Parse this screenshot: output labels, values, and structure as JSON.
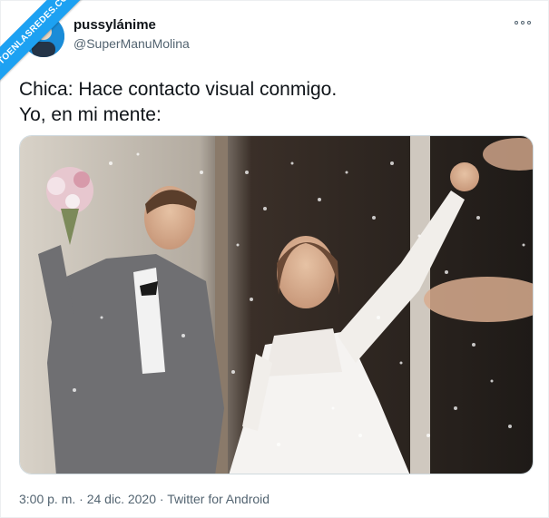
{
  "watermark": "VISTOENLASREDES.COM",
  "tweet": {
    "display_name": "pussylánime",
    "handle": "@SuperManuMolina",
    "text_lines": [
      "Chica: Hace contacto visual conmigo.",
      "Yo, en mi mente:"
    ],
    "time": "3:00 p. m.",
    "separator": "·",
    "date": "24 dic. 2020",
    "source": "Twitter for Android"
  },
  "icons": {
    "more": "more-icon",
    "avatar": "avatar"
  },
  "colors": {
    "accent": "#1da1f2",
    "text": "#0f1419",
    "secondary": "#536471"
  }
}
